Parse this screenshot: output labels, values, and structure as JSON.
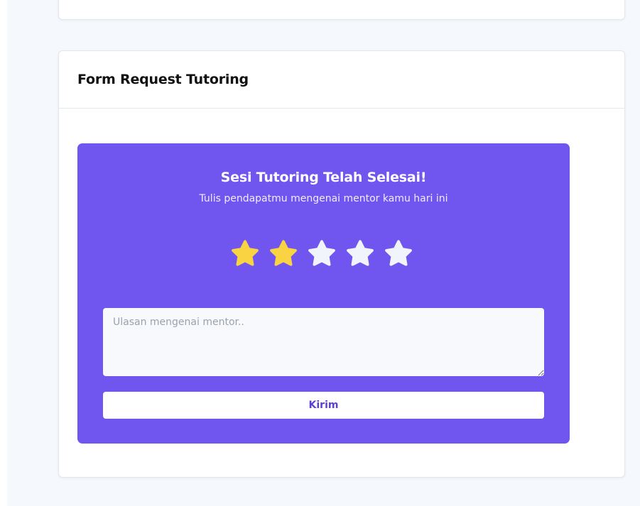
{
  "form": {
    "title": "Form Request Tutoring"
  },
  "review": {
    "heading": "Sesi Tutoring Telah Selesai!",
    "subheading": "Tulis pendapatmu mengenai mentor kamu hari ini",
    "rating": 2,
    "max_rating": 5,
    "star_filled_color": "#f9d342",
    "star_empty_color": "#f2f4fb",
    "textarea_placeholder": "Ulasan mengenai mentor..",
    "submit_label": "Kirim"
  },
  "colors": {
    "panel": "#7056ee",
    "page_background": "#f5f8fc",
    "button_text": "#5b3fd6"
  }
}
